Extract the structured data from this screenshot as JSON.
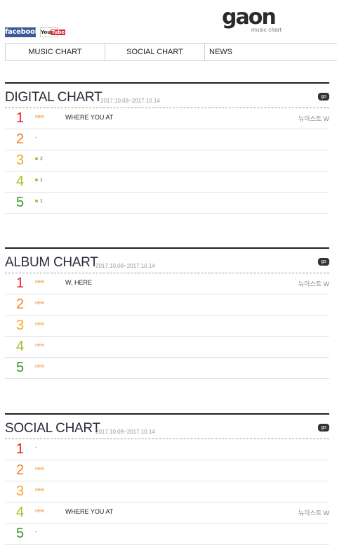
{
  "header": {
    "facebook_label": "facebook",
    "youtube_label_a": "You",
    "youtube_label_b": "Tube",
    "logo_text": "gaon",
    "logo_sub": "music chart"
  },
  "nav": {
    "items": [
      "MUSIC CHART",
      "SOCIAL CHART",
      "NEWS"
    ]
  },
  "go_label": "go",
  "sections": [
    {
      "title": "DIGITAL CHART",
      "date": "2017.10.08~2017.10.14",
      "rows": [
        {
          "rank": "1",
          "change": "new",
          "song": "WHERE YOU AT",
          "artist": "뉴이스트 W"
        },
        {
          "rank": "2",
          "change": "-",
          "song": "",
          "artist": ""
        },
        {
          "rank": "3",
          "change": "2",
          "song": "",
          "artist": ""
        },
        {
          "rank": "4",
          "change": "1",
          "song": "",
          "artist": ""
        },
        {
          "rank": "5",
          "change": "1",
          "song": "",
          "artist": ""
        }
      ]
    },
    {
      "title": "ALBUM CHART",
      "date": "2017.10.08~2017.10.14",
      "rows": [
        {
          "rank": "1",
          "change": "new",
          "song": "W, HERE",
          "artist": "뉴이스트 W"
        },
        {
          "rank": "2",
          "change": "new",
          "song": "",
          "artist": ""
        },
        {
          "rank": "3",
          "change": "new",
          "song": "",
          "artist": ""
        },
        {
          "rank": "4",
          "change": "new",
          "song": "",
          "artist": ""
        },
        {
          "rank": "5",
          "change": "new",
          "song": "",
          "artist": ""
        }
      ]
    },
    {
      "title": "SOCIAL CHART",
      "date": "2017.10.08~2017.10.14",
      "rows": [
        {
          "rank": "1",
          "change": "-",
          "song": "",
          "artist": ""
        },
        {
          "rank": "2",
          "change": "new",
          "song": "",
          "artist": ""
        },
        {
          "rank": "3",
          "change": "new",
          "song": "",
          "artist": ""
        },
        {
          "rank": "4",
          "change": "new",
          "song": "WHERE YOU AT",
          "artist": "뉴이스트 W"
        },
        {
          "rank": "5",
          "change": "-",
          "song": "",
          "artist": ""
        }
      ]
    }
  ]
}
